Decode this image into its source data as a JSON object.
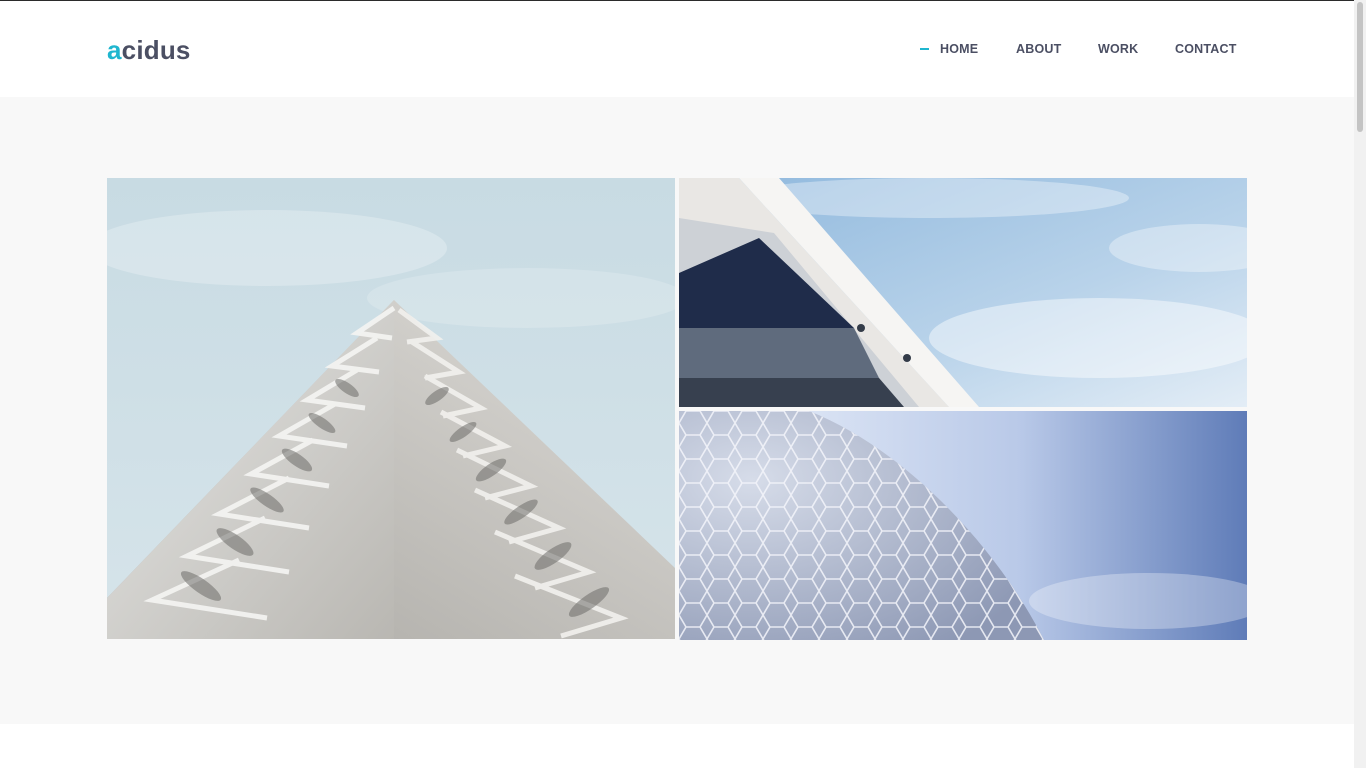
{
  "brand": {
    "logo_initial": "a",
    "logo_rest": "cidus",
    "accent_color": "#1fb6cf",
    "text_color": "#4b4f63"
  },
  "nav": {
    "active_item": "home",
    "items": [
      {
        "id": "home",
        "label": "HOME"
      },
      {
        "id": "about",
        "label": "ABOUT"
      },
      {
        "id": "work",
        "label": "WORK"
      },
      {
        "id": "contact",
        "label": "CONTACT"
      }
    ]
  },
  "gallery": {
    "images": [
      {
        "subject": "stepped white facade building against pale sky"
      },
      {
        "subject": "angular white building edge with windows against blue sky"
      },
      {
        "subject": "hexagonal tiled dome against blue sky"
      }
    ]
  }
}
